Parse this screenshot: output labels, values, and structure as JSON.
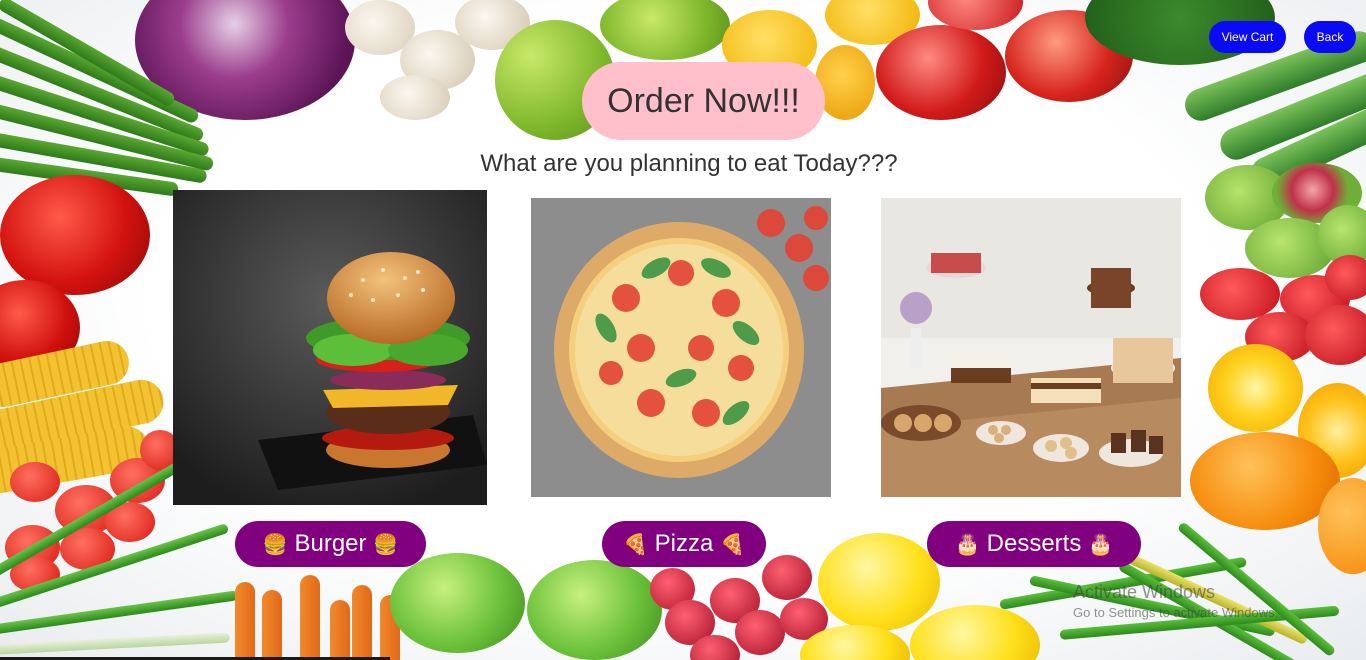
{
  "nav": {
    "view_cart_label": "View Cart",
    "back_label": "Back"
  },
  "hero": {
    "title": "Order Now!!!",
    "subtitle": "What are you planning to eat Today???"
  },
  "menu": [
    {
      "label": "Burger",
      "emoji": "🍔",
      "icon": "burger-icon"
    },
    {
      "label": "Pizza",
      "emoji": "🍕",
      "icon": "pizza-icon"
    },
    {
      "label": "Desserts",
      "emoji": "🎂",
      "icon": "cake-icon"
    }
  ],
  "watermark": {
    "title": "Activate Windows",
    "subtitle": "Go to Settings to activate Windows."
  },
  "colors": {
    "nav_button": "#0a0af5",
    "title_pill": "#ffc0cb",
    "category_button": "#800080"
  }
}
